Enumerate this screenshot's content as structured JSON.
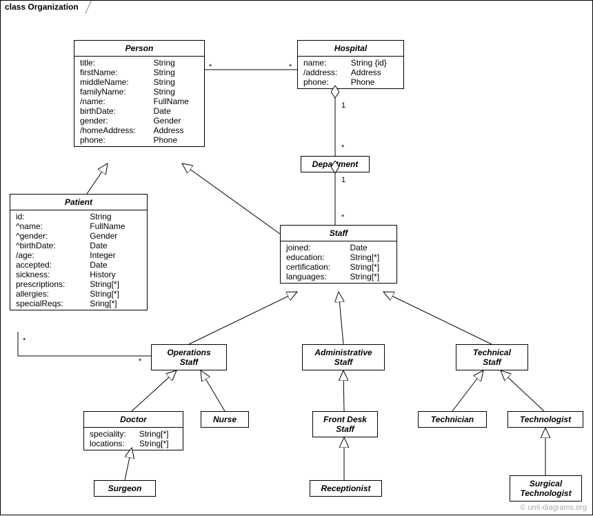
{
  "frame": {
    "label": "class Organization"
  },
  "watermark": "© uml-diagrams.org",
  "classes": {
    "person": {
      "title": "Person",
      "attrs": [
        [
          "title:",
          "String"
        ],
        [
          "firstName:",
          "String"
        ],
        [
          "middleName:",
          "String"
        ],
        [
          "familyName:",
          "String"
        ],
        [
          "/name:",
          "FullName"
        ],
        [
          "birthDate:",
          "Date"
        ],
        [
          "gender:",
          "Gender"
        ],
        [
          "/homeAddress:",
          "Address"
        ],
        [
          "phone:",
          "Phone"
        ]
      ]
    },
    "hospital": {
      "title": "Hospital",
      "attrs": [
        [
          "name:",
          "String {id}"
        ],
        [
          "/address:",
          "Address"
        ],
        [
          "phone:",
          "Phone"
        ]
      ]
    },
    "department": {
      "title": "Department",
      "attrs": []
    },
    "patient": {
      "title": "Patient",
      "attrs": [
        [
          "id:",
          "String"
        ],
        [
          "^name:",
          "FullName"
        ],
        [
          "^gender:",
          "Gender"
        ],
        [
          "^birthDate:",
          "Date"
        ],
        [
          "/age:",
          "Integer"
        ],
        [
          "accepted:",
          "Date"
        ],
        [
          "sickness:",
          "History"
        ],
        [
          "prescriptions:",
          "String[*]"
        ],
        [
          "allergies:",
          "String[*]"
        ],
        [
          "specialReqs:",
          "Sring[*]"
        ]
      ]
    },
    "staff": {
      "title": "Staff",
      "attrs": [
        [
          "joined:",
          "Date"
        ],
        [
          "education:",
          "String[*]"
        ],
        [
          "certification:",
          "String[*]"
        ],
        [
          "languages:",
          "String[*]"
        ]
      ]
    },
    "opsStaff": {
      "title": "Operations\nStaff",
      "attrs": []
    },
    "adminStaff": {
      "title": "Administrative\nStaff",
      "attrs": []
    },
    "techStaff": {
      "title": "Technical\nStaff",
      "attrs": []
    },
    "doctor": {
      "title": "Doctor",
      "attrs": [
        [
          "speciality:",
          "String[*]"
        ],
        [
          "locations:",
          "String[*]"
        ]
      ]
    },
    "nurse": {
      "title": "Nurse",
      "attrs": []
    },
    "frontDesk": {
      "title": "Front Desk\nStaff",
      "attrs": []
    },
    "technician": {
      "title": "Technician",
      "attrs": []
    },
    "technologist": {
      "title": "Technologist",
      "attrs": []
    },
    "surgeon": {
      "title": "Surgeon",
      "attrs": []
    },
    "receptionist": {
      "title": "Receptionist",
      "attrs": []
    },
    "surgTech": {
      "title": "Surgical\nTechnologist",
      "attrs": []
    }
  },
  "mult": {
    "star": "*",
    "one": "1"
  }
}
